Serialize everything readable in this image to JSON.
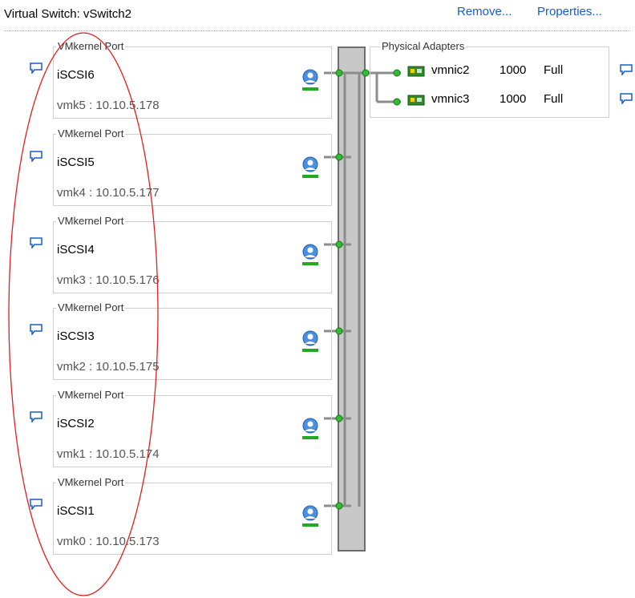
{
  "header": {
    "title": "Virtual Switch: vSwitch2",
    "remove_label": "Remove...",
    "properties_label": "Properties..."
  },
  "ports": [
    {
      "legend": "VMkernel Port",
      "name": "iSCSI6",
      "address": "vmk5 : 10.10.5.178"
    },
    {
      "legend": "VMkernel Port",
      "name": "iSCSI5",
      "address": "vmk4 : 10.10.5.177"
    },
    {
      "legend": "VMkernel Port",
      "name": "iSCSI4",
      "address": "vmk3 : 10.10.5.176"
    },
    {
      "legend": "VMkernel Port",
      "name": "iSCSI3",
      "address": "vmk2 : 10.10.5.175"
    },
    {
      "legend": "VMkernel Port",
      "name": "iSCSI2",
      "address": "vmk1 : 10.10.5.174"
    },
    {
      "legend": "VMkernel Port",
      "name": "iSCSI1",
      "address": "vmk0 : 10.10.5.173"
    }
  ],
  "physical_adapters": {
    "legend": "Physical Adapters",
    "nics": [
      {
        "name": "vmnic2",
        "speed": "1000",
        "duplex": "Full"
      },
      {
        "name": "vmnic3",
        "speed": "1000",
        "duplex": "Full"
      }
    ]
  },
  "icons": {
    "port": "vmkernel-globe-icon",
    "nic": "network-card-icon",
    "comment": "speech-bubble-icon"
  },
  "colors": {
    "link": "#1a5dc8",
    "annotation": "#e02020",
    "connector": "#22aa22"
  }
}
